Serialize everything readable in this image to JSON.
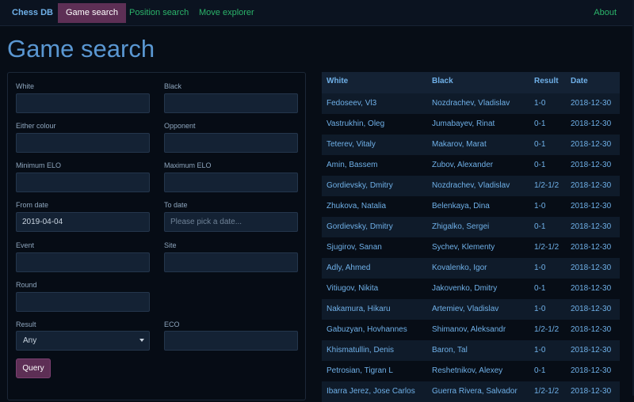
{
  "nav": {
    "brand": "Chess DB",
    "links": [
      "Game search",
      "Position search",
      "Move explorer"
    ],
    "active": "Game search",
    "about": "About"
  },
  "page_title": "Game search",
  "form": {
    "white_label": "White",
    "white_value": "",
    "black_label": "Black",
    "black_value": "",
    "either_label": "Either colour",
    "either_value": "",
    "opponent_label": "Opponent",
    "opponent_value": "",
    "min_elo_label": "Minimum ELO",
    "min_elo_value": "",
    "max_elo_label": "Maximum ELO",
    "max_elo_value": "",
    "from_date_label": "From date",
    "from_date_value": "2019-04-04",
    "to_date_label": "To date",
    "to_date_placeholder": "Please pick a date...",
    "event_label": "Event",
    "event_value": "",
    "site_label": "Site",
    "site_value": "",
    "round_label": "Round",
    "round_value": "",
    "result_label": "Result",
    "result_value": "Any",
    "eco_label": "ECO",
    "eco_value": "",
    "query_label": "Query"
  },
  "table": {
    "headers": [
      "White",
      "Black",
      "Result",
      "Date"
    ],
    "rows": [
      {
        "white": "Fedoseev, Vl3",
        "black": "Nozdrachev, Vladislav",
        "result": "1-0",
        "date": "2018-12-30"
      },
      {
        "white": "Vastrukhin, Oleg",
        "black": "Jumabayev, Rinat",
        "result": "0-1",
        "date": "2018-12-30"
      },
      {
        "white": "Teterev, Vitaly",
        "black": "Makarov, Marat",
        "result": "0-1",
        "date": "2018-12-30"
      },
      {
        "white": "Amin, Bassem",
        "black": "Zubov, Alexander",
        "result": "0-1",
        "date": "2018-12-30"
      },
      {
        "white": "Gordievsky, Dmitry",
        "black": "Nozdrachev, Vladislav",
        "result": "1/2-1/2",
        "date": "2018-12-30"
      },
      {
        "white": "Zhukova, Natalia",
        "black": "Belenkaya, Dina",
        "result": "1-0",
        "date": "2018-12-30"
      },
      {
        "white": "Gordievsky, Dmitry",
        "black": "Zhigalko, Sergei",
        "result": "0-1",
        "date": "2018-12-30"
      },
      {
        "white": "Sjugirov, Sanan",
        "black": "Sychev, Klementy",
        "result": "1/2-1/2",
        "date": "2018-12-30"
      },
      {
        "white": "Adly, Ahmed",
        "black": "Kovalenko, Igor",
        "result": "1-0",
        "date": "2018-12-30"
      },
      {
        "white": "Vitiugov, Nikita",
        "black": "Jakovenko, Dmitry",
        "result": "0-1",
        "date": "2018-12-30"
      },
      {
        "white": "Nakamura, Hikaru",
        "black": "Artemiev, Vladislav",
        "result": "1-0",
        "date": "2018-12-30"
      },
      {
        "white": "Gabuzyan, Hovhannes",
        "black": "Shimanov, Aleksandr",
        "result": "1/2-1/2",
        "date": "2018-12-30"
      },
      {
        "white": "Khismatullin, Denis",
        "black": "Baron, Tal",
        "result": "1-0",
        "date": "2018-12-30"
      },
      {
        "white": "Petrosian, Tigran L",
        "black": "Reshetnikov, Alexey",
        "result": "0-1",
        "date": "2018-12-30"
      },
      {
        "white": "Ibarra Jerez, Jose Carlos",
        "black": "Guerra Rivera, Salvador",
        "result": "1/2-1/2",
        "date": "2018-12-30"
      }
    ]
  },
  "colors": {
    "background": "#070d16",
    "accent": "#5d2f55",
    "link": "#2bb36a",
    "title": "#5a97d2",
    "table_text": "#6fb0e8"
  }
}
